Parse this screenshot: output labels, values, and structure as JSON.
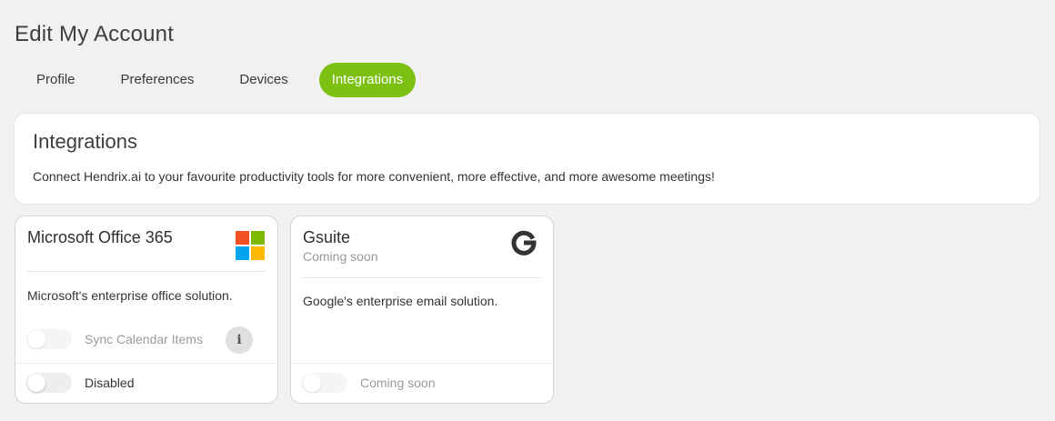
{
  "page": {
    "title": "Edit My Account"
  },
  "tabs": [
    {
      "label": "Profile",
      "active": false
    },
    {
      "label": "Preferences",
      "active": false
    },
    {
      "label": "Devices",
      "active": false
    },
    {
      "label": "Integrations",
      "active": true
    }
  ],
  "intro": {
    "title": "Integrations",
    "description": "Connect Hendrix.ai to your favourite productivity tools for more convenient, more effective, and more awesome meetings!"
  },
  "integrations": [
    {
      "name": "Microsoft Office 365",
      "icon": "microsoft-logo-icon",
      "description": "Microsoft's enterprise office solution.",
      "sync_label": "Sync Calendar Items",
      "sync_enabled": false,
      "info_icon": "i",
      "status_label": "Disabled",
      "enabled": false
    },
    {
      "name": "Gsuite",
      "subtitle": "Coming soon",
      "icon": "google-g-logo-icon",
      "description": "Google's enterprise email solution.",
      "status_label": "Coming soon",
      "enabled": false
    }
  ],
  "colors": {
    "accent": "#7cc112",
    "background": "#f1f1f1",
    "card": "#ffffff",
    "ms_red": "#f25022",
    "ms_green": "#7fba00",
    "ms_blue": "#00a4ef",
    "ms_yellow": "#ffb900"
  }
}
